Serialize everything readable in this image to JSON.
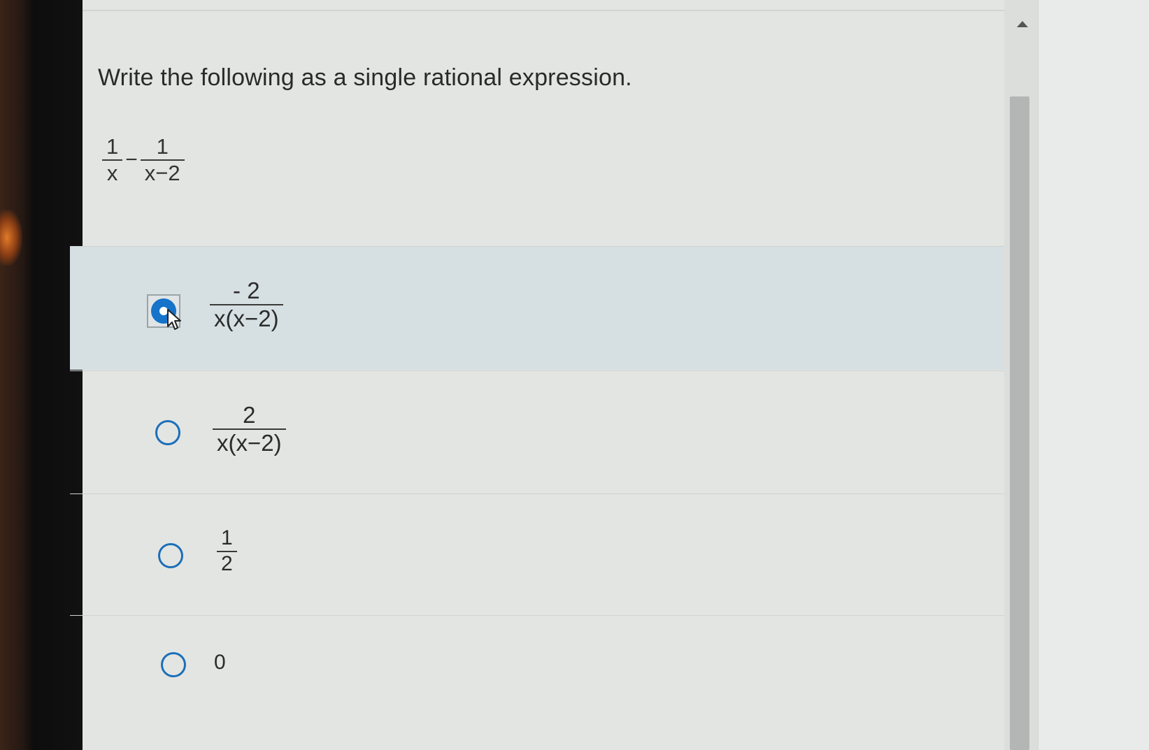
{
  "question": {
    "prompt": "Write the following as a single rational expression.",
    "expression": {
      "term1": {
        "numerator": "1",
        "denominator": "x"
      },
      "operator": "−",
      "term2": {
        "numerator": "1",
        "denominator": "x−2"
      }
    }
  },
  "choices": [
    {
      "id": "a",
      "type": "fraction",
      "numerator": "- 2",
      "denominator": "x(x−2)",
      "selected": true
    },
    {
      "id": "b",
      "type": "fraction",
      "numerator": "2",
      "denominator": "x(x−2)",
      "selected": false
    },
    {
      "id": "c",
      "type": "fraction",
      "numerator": "1",
      "denominator": "2",
      "selected": false
    },
    {
      "id": "d",
      "type": "text",
      "value": "0",
      "selected": false
    }
  ],
  "colors": {
    "accent": "#1573c9",
    "selected_row": "#d6e0e2",
    "background": "#e3e5e3"
  }
}
